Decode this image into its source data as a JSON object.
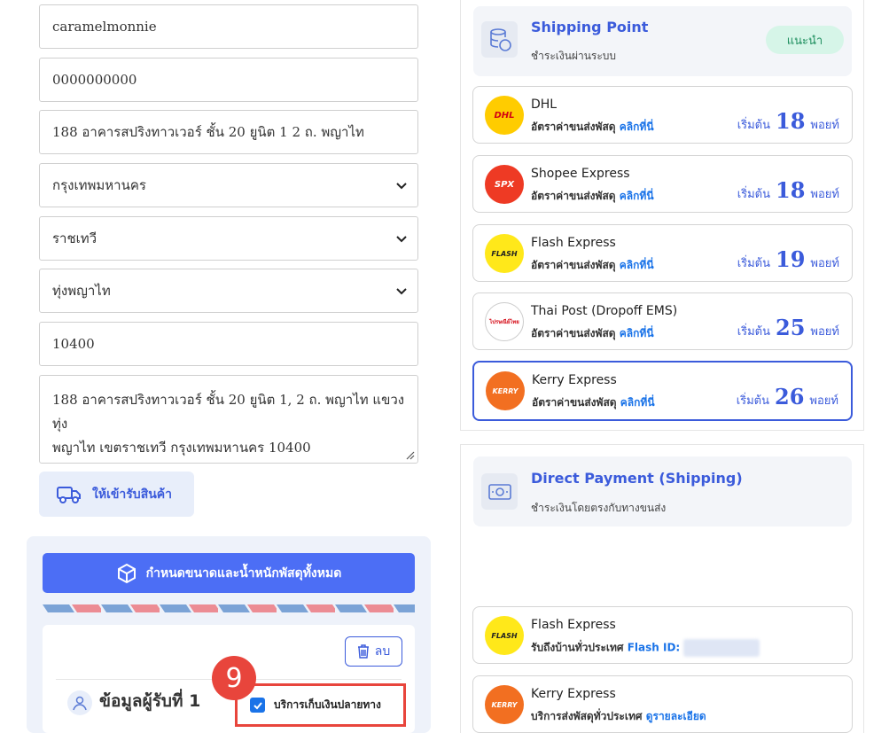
{
  "form": {
    "name": "caramelmonnie",
    "phone": "0000000000",
    "address": "188 อาคารสปริงทาวเวอร์ ชั้น 20 ยูนิต 1 2 ถ. พญาไท",
    "province": "กรุงเทพมหานคร",
    "district": "ราชเทวี",
    "subdistrict": "ทุ่งพญาไท",
    "postcode": "10400",
    "full_address_line1": "188 อาคารสปริงทาวเวอร์ ชั้น 20 ยูนิต 1, 2 ถ. พญาไท แขวงทุ่ง",
    "full_address_line2": "พญาไท เขตราชเทวี กรุงเทพมหานคร 10400",
    "pickup_label": "ให้เข้ารับสินค้า"
  },
  "parcel": {
    "dims_label": "กำหนดขนาดและน้ำหนักพัสดุทั้งหมด",
    "delete_label": "ลบ",
    "recipient_title": "ข้อมูลผู้รับที่ 1",
    "cod_label": "บริการเก็บเงินปลายทาง",
    "step_number": "9"
  },
  "shipping_point": {
    "title": "Shipping Point",
    "subtitle": "ชำระเงินผ่านระบบ",
    "badge": "แนะนำ",
    "carriers": [
      {
        "name": "DHL",
        "sub": "อัตราค่าขนส่งพัสดุ",
        "link": "คลิกที่นี่",
        "prefix": "เริ่มต้น",
        "price": "18",
        "unit": "พอยท์",
        "logo": "DHL"
      },
      {
        "name": "Shopee Express",
        "sub": "อัตราค่าขนส่งพัสดุ",
        "link": "คลิกที่นี่",
        "prefix": "เริ่มต้น",
        "price": "18",
        "unit": "พอยท์",
        "logo": "SPX"
      },
      {
        "name": "Flash Express",
        "sub": "อัตราค่าขนส่งพัสดุ",
        "link": "คลิกที่นี่",
        "prefix": "เริ่มต้น",
        "price": "19",
        "unit": "พอยท์",
        "logo": "FLASH"
      },
      {
        "name": "Thai Post (Dropoff EMS)",
        "sub": "อัตราค่าขนส่งพัสดุ",
        "link": "คลิกที่นี่",
        "prefix": "เริ่มต้น",
        "price": "25",
        "unit": "พอยท์",
        "logo": "ไปรษณีย์ไทย"
      },
      {
        "name": "Kerry Express",
        "sub": "อัตราค่าขนส่งพัสดุ",
        "link": "คลิกที่นี่",
        "prefix": "เริ่มต้น",
        "price": "26",
        "unit": "พอยท์",
        "logo": "KERRY"
      }
    ]
  },
  "direct_payment": {
    "title": "Direct Payment (Shipping)",
    "subtitle": "ชำระเงินโดยตรงกับทางขนส่ง",
    "carriers": [
      {
        "name": "Flash Express",
        "sub": "รับถึงบ้านทั่วประเทศ",
        "link": "Flash ID:",
        "logo": "FLASH"
      },
      {
        "name": "Kerry Express",
        "sub": "บริการส่งพัสดุทั่วประเทศ",
        "link": "ดูรายละเอียด",
        "logo": "KERRY"
      }
    ]
  },
  "colors": {
    "accent": "#3b5bdb",
    "primary_button": "#4c6ef5",
    "highlight": "#e8453c",
    "recommend_bg": "#d6f5e8"
  }
}
